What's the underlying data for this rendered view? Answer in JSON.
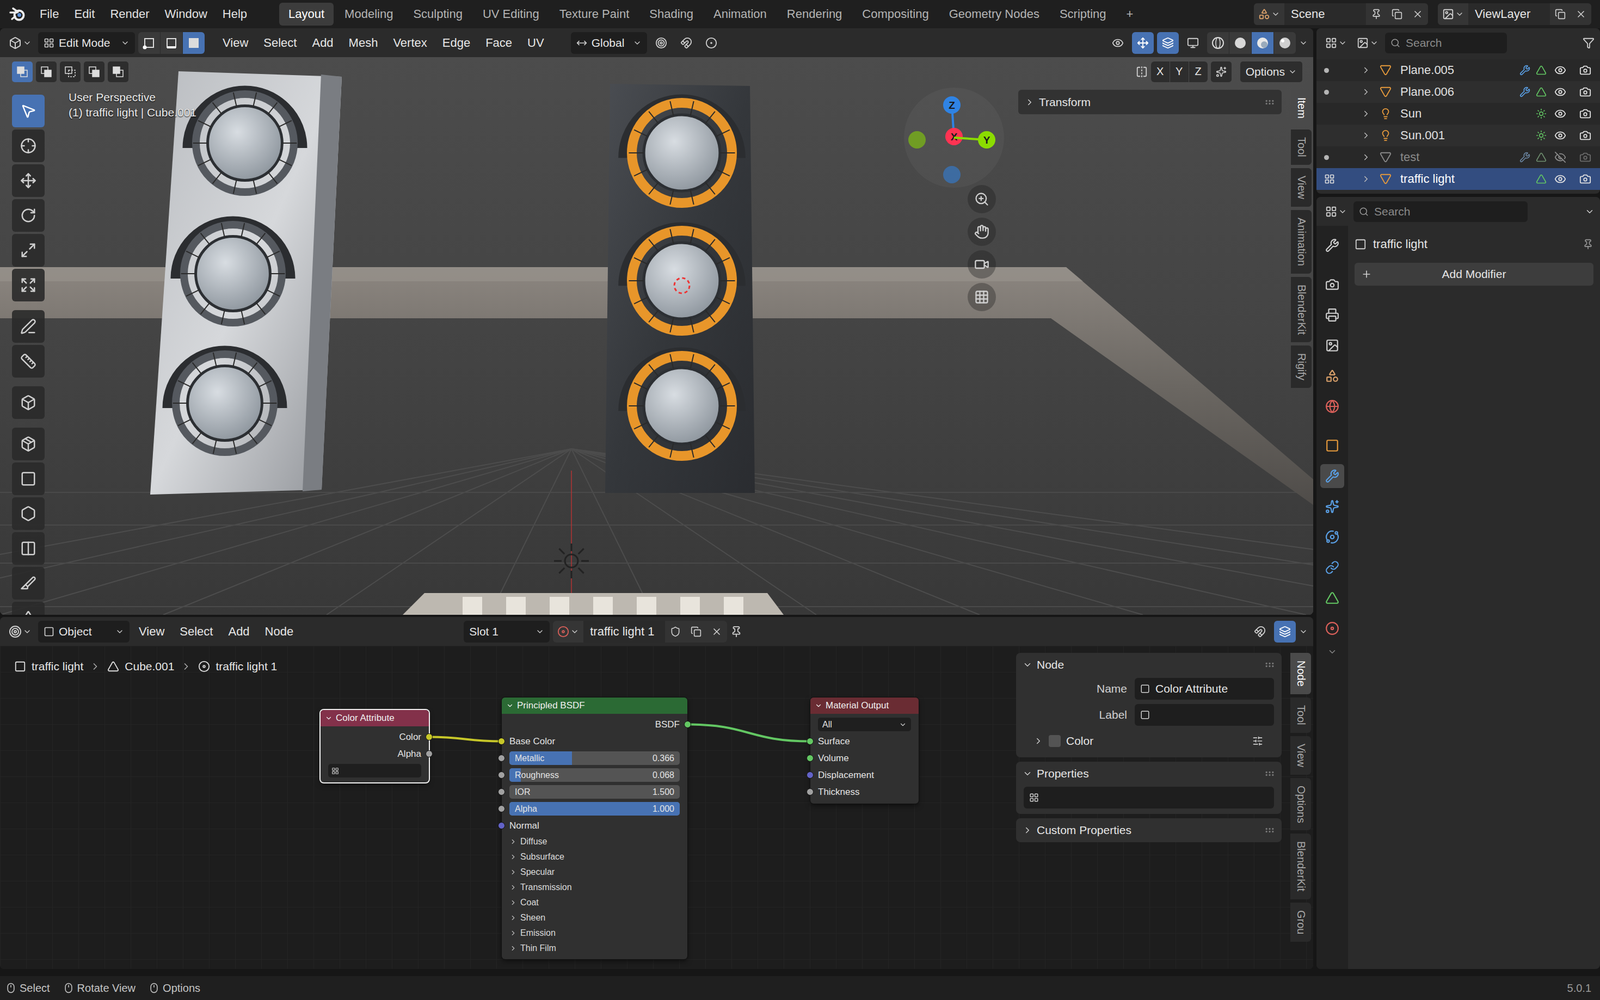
{
  "topbar": {
    "menus": [
      "File",
      "Edit",
      "Render",
      "Window",
      "Help"
    ],
    "workspaces": [
      {
        "label": "Layout",
        "selected": true
      },
      {
        "label": "Modeling",
        "selected": false
      },
      {
        "label": "Sculpting",
        "selected": false
      },
      {
        "label": "UV Editing",
        "selected": false
      },
      {
        "label": "Texture Paint",
        "selected": false
      },
      {
        "label": "Shading",
        "selected": false
      },
      {
        "label": "Animation",
        "selected": false
      },
      {
        "label": "Rendering",
        "selected": false
      },
      {
        "label": "Compositing",
        "selected": false
      },
      {
        "label": "Geometry Nodes",
        "selected": false
      },
      {
        "label": "Scripting",
        "selected": false
      }
    ],
    "add_workspace": "+",
    "scene": "Scene",
    "view_layer": "ViewLayer"
  },
  "viewport": {
    "mode": "Edit Mode",
    "select_modes": [
      {
        "kind": "vertex",
        "selected": false
      },
      {
        "kind": "edge",
        "selected": false
      },
      {
        "kind": "face",
        "selected": true
      }
    ],
    "menus": [
      "View",
      "Select",
      "Add",
      "Mesh",
      "Vertex",
      "Edge",
      "Face",
      "UV"
    ],
    "orientation": "Global",
    "shading": [
      {
        "kind": "wireframe",
        "selected": false
      },
      {
        "kind": "solid",
        "selected": false
      },
      {
        "kind": "material",
        "selected": true
      },
      {
        "kind": "rendered",
        "selected": false
      }
    ],
    "selection_ops": [
      {
        "kind": "set",
        "selected": true
      },
      {
        "kind": "extend",
        "selected": false
      },
      {
        "kind": "subtract",
        "selected": false
      },
      {
        "kind": "invert",
        "selected": false
      },
      {
        "kind": "intersect",
        "selected": false
      }
    ],
    "mirror_axes": [
      {
        "label": "X",
        "on": false
      },
      {
        "label": "Y",
        "on": false
      },
      {
        "label": "Z",
        "on": false
      }
    ],
    "options": "Options",
    "view_name": "User Perspective",
    "object_info": "(1) traffic light | Cube.001",
    "tools": [
      {
        "kind": "select_box",
        "selected": true
      },
      {
        "kind": "cursor",
        "selected": false
      },
      {
        "kind": "move",
        "selected": false
      },
      {
        "kind": "rotate",
        "selected": false
      },
      {
        "kind": "scale",
        "selected": false
      },
      {
        "kind": "transform",
        "selected": false
      },
      {
        "kind": "annotate",
        "selected": false
      },
      {
        "kind": "measure",
        "selected": false
      },
      {
        "kind": "add_cube",
        "selected": false
      },
      {
        "kind": "extrude",
        "selected": false
      },
      {
        "kind": "inset",
        "selected": false
      },
      {
        "kind": "bevel",
        "selected": false
      },
      {
        "kind": "loop_cut",
        "selected": false
      },
      {
        "kind": "knife",
        "selected": false
      },
      {
        "kind": "poly_build",
        "selected": false
      }
    ],
    "gizmo_axes": [
      {
        "label": "Z",
        "kind": "z",
        "color": "#2f83e4"
      },
      {
        "label": "X",
        "kind": "x",
        "color": "#ff3352"
      },
      {
        "label": "Y",
        "kind": "y",
        "color": "#8bdc00"
      }
    ],
    "scene": {
      "housings": [
        {
          "kind": "left",
          "selected": false
        },
        {
          "kind": "right",
          "selected": true
        }
      ]
    },
    "transform_panel": {
      "label": "Transform",
      "expanded": false
    },
    "sidebar_tabs": [
      {
        "label": "Item",
        "selected": true
      },
      {
        "label": "Tool",
        "selected": false
      },
      {
        "label": "View",
        "selected": false
      },
      {
        "label": "Animation",
        "selected": false
      },
      {
        "label": "BlenderKit",
        "selected": false
      },
      {
        "label": "Rigify",
        "selected": false
      }
    ]
  },
  "outliner": {
    "search": "Search",
    "rows": [
      {
        "name": "Plane.005",
        "kind": "mesh",
        "gutter": "dot",
        "modifiers": true,
        "visible": true,
        "renderable": true,
        "disabled": false,
        "selected": false
      },
      {
        "name": "Plane.006",
        "kind": "mesh",
        "gutter": "dot",
        "modifiers": true,
        "visible": true,
        "renderable": true,
        "disabled": false,
        "selected": false
      },
      {
        "name": "Sun",
        "kind": "light",
        "gutter": "none",
        "modifiers": false,
        "visible": true,
        "renderable": true,
        "disabled": false,
        "selected": false
      },
      {
        "name": "Sun.001",
        "kind": "light",
        "gutter": "none",
        "modifiers": false,
        "visible": true,
        "renderable": true,
        "disabled": false,
        "selected": false
      },
      {
        "name": "test",
        "kind": "mesh",
        "gutter": "dot",
        "modifiers": true,
        "visible": false,
        "renderable": false,
        "disabled": true,
        "selected": false
      },
      {
        "name": "traffic light",
        "kind": "mesh",
        "gutter": "edit",
        "modifiers": false,
        "visible": true,
        "renderable": true,
        "disabled": false,
        "selected": true
      }
    ]
  },
  "properties": {
    "search": "Search",
    "object": "traffic light",
    "add_modifier": "Add Modifier",
    "tabs": [
      {
        "kind": "tool",
        "selected": false
      },
      {
        "kind": "render",
        "selected": false
      },
      {
        "kind": "output",
        "selected": false
      },
      {
        "kind": "view_layer",
        "selected": false
      },
      {
        "kind": "scene",
        "selected": false
      },
      {
        "kind": "world",
        "selected": false
      },
      {
        "kind": "object",
        "selected": false
      },
      {
        "kind": "modifiers",
        "selected": true
      },
      {
        "kind": "particles",
        "selected": false
      },
      {
        "kind": "physics",
        "selected": false
      },
      {
        "kind": "constraints",
        "selected": false
      },
      {
        "kind": "data",
        "selected": false
      },
      {
        "kind": "material",
        "selected": false
      }
    ]
  },
  "node_editor": {
    "mode": "Object",
    "menus": [
      "View",
      "Select",
      "Add",
      "Node"
    ],
    "slot": "Slot 1",
    "material": "traffic light 1",
    "breadcrumb": [
      "traffic light",
      "Cube.001",
      "traffic light 1"
    ],
    "nodes": [
      {
        "title": "Color Attribute",
        "color": "#83314a",
        "selected": true,
        "outputs": [
          {
            "label": "Color",
            "socket": "color"
          },
          {
            "label": "Alpha",
            "socket": "float"
          }
        ],
        "inputs": [
          {
            "kind": "field"
          }
        ],
        "panels": []
      },
      {
        "title": "Principled BSDF",
        "color": "#2b6a34",
        "selected": false,
        "outputs": [
          {
            "label": "BSDF",
            "socket": "shader"
          }
        ],
        "inputs": [
          {
            "kind": "socket",
            "label": "Base Color",
            "socket": "color"
          },
          {
            "kind": "slider",
            "label": "Metallic",
            "value": "0.366",
            "level": 0.366,
            "socket": "float"
          },
          {
            "kind": "slider",
            "label": "Roughness",
            "value": "0.068",
            "level": 0.068,
            "socket": "float"
          },
          {
            "kind": "slider",
            "label": "IOR",
            "value": "1.500",
            "level": 0,
            "socket": "float"
          },
          {
            "kind": "slider",
            "label": "Alpha",
            "value": "1.000",
            "level": 1,
            "socket": "float"
          },
          {
            "kind": "socket",
            "label": "Normal",
            "socket": "vector"
          }
        ],
        "panels": [
          "Diffuse",
          "Subsurface",
          "Specular",
          "Transmission",
          "Coat",
          "Sheen",
          "Emission",
          "Thin Film"
        ]
      },
      {
        "title": "Material Output",
        "color": "#6a2c33",
        "selected": false,
        "outputs": [],
        "inputs": [
          {
            "kind": "select",
            "label": "All"
          },
          {
            "kind": "socket",
            "label": "Surface",
            "socket": "shader"
          },
          {
            "kind": "socket",
            "label": "Volume",
            "socket": "shader"
          },
          {
            "kind": "socket",
            "label": "Displacement",
            "socket": "vector"
          },
          {
            "kind": "socket",
            "label": "Thickness",
            "socket": "float"
          }
        ],
        "panels": []
      }
    ],
    "links": [
      {
        "from_node": 0,
        "from_socket": "Color",
        "to_node": 1,
        "to_socket": "Base Color"
      },
      {
        "from_node": 1,
        "from_socket": "BSDF",
        "to_node": 2,
        "to_socket": "Surface"
      }
    ],
    "sidebar": {
      "node_panel": {
        "title": "Node",
        "expanded": true,
        "fields": [
          {
            "label": "Name",
            "value": "Color Attribute"
          },
          {
            "label": "Label",
            "value": ""
          }
        ],
        "subpanel": {
          "title": "Color",
          "expanded": false,
          "checked": false
        }
      },
      "properties_panel": {
        "title": "Properties",
        "expanded": true
      },
      "custom_properties": {
        "title": "Custom Properties",
        "expanded": false
      },
      "tabs": [
        {
          "label": "Node",
          "selected": true
        },
        {
          "label": "Tool",
          "selected": false
        },
        {
          "label": "View",
          "selected": false
        },
        {
          "label": "Options",
          "selected": false
        },
        {
          "label": "BlenderKit",
          "selected": false
        },
        {
          "label": "Grou",
          "selected": false
        }
      ]
    }
  },
  "status_bar": {
    "items": [
      {
        "label": "Select",
        "kind": "left"
      },
      {
        "label": "Rotate View",
        "kind": "middle"
      },
      {
        "label": "Options",
        "kind": "right"
      }
    ],
    "version": "5.0.1"
  }
}
